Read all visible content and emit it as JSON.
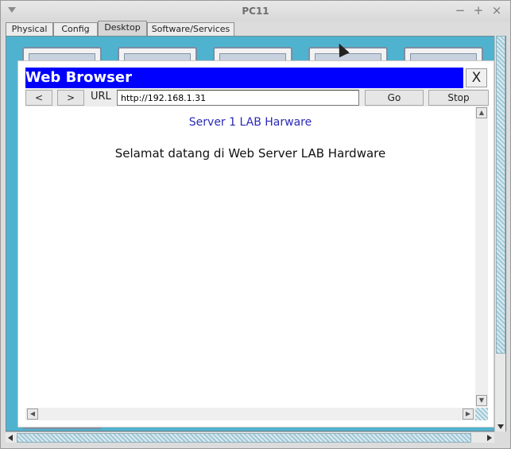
{
  "window": {
    "title": "PC11"
  },
  "tabs": [
    {
      "label": "Physical"
    },
    {
      "label": "Config"
    },
    {
      "label": "Desktop"
    },
    {
      "label": "Software/Services"
    }
  ],
  "active_tab": "Desktop",
  "browser": {
    "title": "Web Browser",
    "close_label": "X",
    "back_label": "<",
    "forward_label": ">",
    "url_label": "URL",
    "url_value": "http://192.168.1.31",
    "go_label": "Go",
    "stop_label": "Stop",
    "page": {
      "heading": "Server 1 LAB Harware",
      "body": "Selamat datang di Web Server LAB Hardware"
    }
  },
  "colors": {
    "browser_title_bg": "#0000ff",
    "desktop_bg": "#4fb3cf",
    "heading_text": "#2a2ab8"
  },
  "icons": [
    "menu-arrow-icon",
    "minimize-icon",
    "maximize-icon",
    "close-icon",
    "mouse-cursor-icon"
  ]
}
